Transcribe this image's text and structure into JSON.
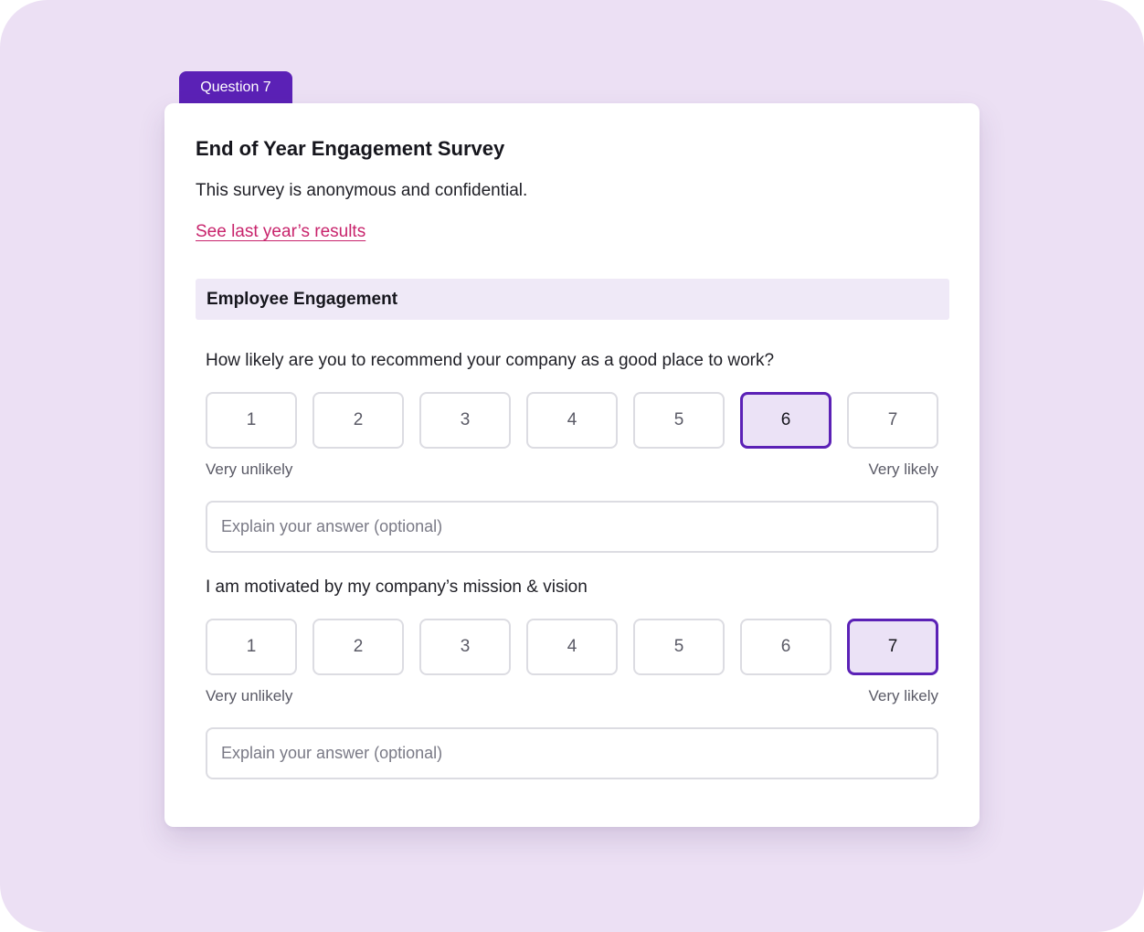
{
  "question_tab": "Question 7",
  "survey": {
    "title": "End of Year Engagement Survey",
    "description": "This survey is anonymous and confidential.",
    "results_link": "See last year’s results"
  },
  "section": {
    "title": "Employee Engagement"
  },
  "questions": [
    {
      "text": "How likely are you to recommend your company as a good place to work?",
      "options": [
        "1",
        "2",
        "3",
        "4",
        "5",
        "6",
        "7"
      ],
      "selected": "6",
      "low_label": "Very unlikely",
      "high_label": "Very likely",
      "explain_placeholder": "Explain your answer (optional)",
      "explain_value": ""
    },
    {
      "text": "I am motivated by my company’s mission & vision",
      "options": [
        "1",
        "2",
        "3",
        "4",
        "5",
        "6",
        "7"
      ],
      "selected": "7",
      "low_label": "Very unlikely",
      "high_label": "Very likely",
      "explain_placeholder": "Explain your answer (optional)",
      "explain_value": ""
    }
  ],
  "colors": {
    "background": "#ece0f4",
    "accent": "#5b21b6",
    "selected_fill": "#ebe2f6",
    "link": "#c8246c",
    "section_fill": "#efe9f7"
  }
}
